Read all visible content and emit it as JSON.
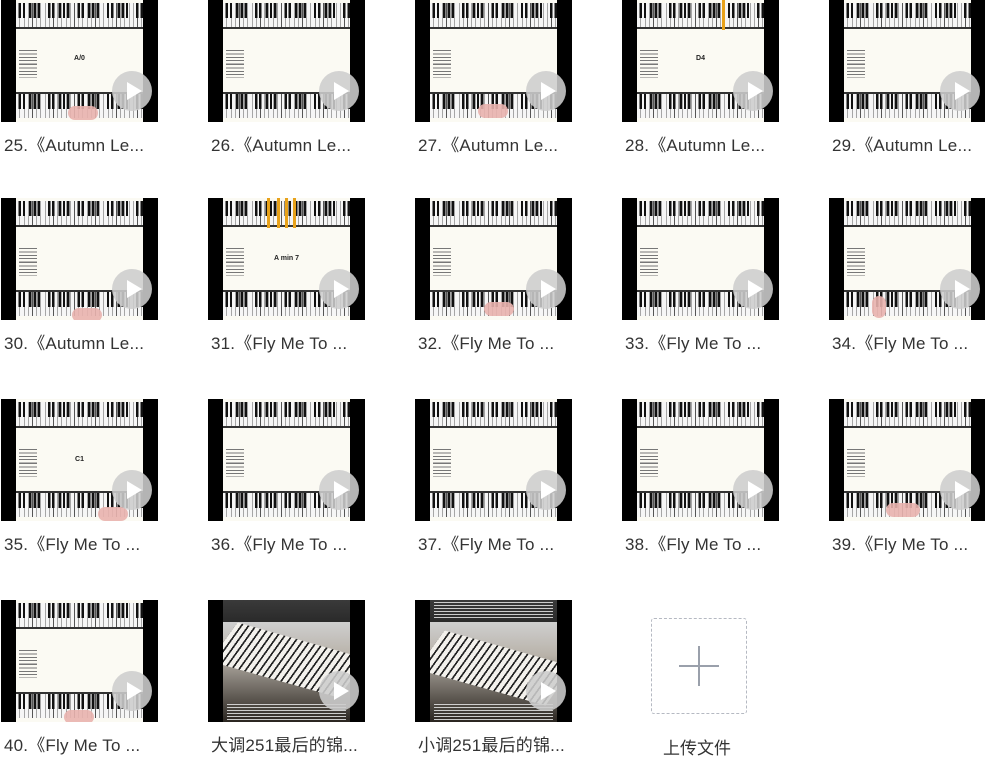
{
  "files": [
    {
      "title": "25.《Autumn Le...",
      "chord": "A/0"
    },
    {
      "title": "26.《Autumn Le...",
      "chord": ""
    },
    {
      "title": "27.《Autumn Le...",
      "chord": ""
    },
    {
      "title": "28.《Autumn Le...",
      "chord": "D4"
    },
    {
      "title": "29.《Autumn Le...",
      "chord": ""
    },
    {
      "title": "30.《Autumn Le...",
      "chord": ""
    },
    {
      "title": "31.《Fly Me To ...",
      "chord": "A min 7"
    },
    {
      "title": "32.《Fly Me To ...",
      "chord": ""
    },
    {
      "title": "33.《Fly Me To ...",
      "chord": ""
    },
    {
      "title": "34.《Fly Me To ...",
      "chord": ""
    },
    {
      "title": "35.《Fly Me To ...",
      "chord": "C1"
    },
    {
      "title": "36.《Fly Me To ...",
      "chord": ""
    },
    {
      "title": "37.《Fly Me To ...",
      "chord": ""
    },
    {
      "title": "38.《Fly Me To ...",
      "chord": ""
    },
    {
      "title": "39.《Fly Me To ...",
      "chord": ""
    },
    {
      "title": "40.《Fly Me To ...",
      "chord": ""
    },
    {
      "title": "大调251最后的锦...",
      "chord": ""
    },
    {
      "title": "小调251最后的锦...",
      "chord": ""
    }
  ],
  "upload": {
    "label": "上传文件",
    "icon": "plus-icon"
  },
  "colors": {
    "accent": "#e8a21a",
    "label": "#333333",
    "upload_border": "#b5b9c2"
  }
}
